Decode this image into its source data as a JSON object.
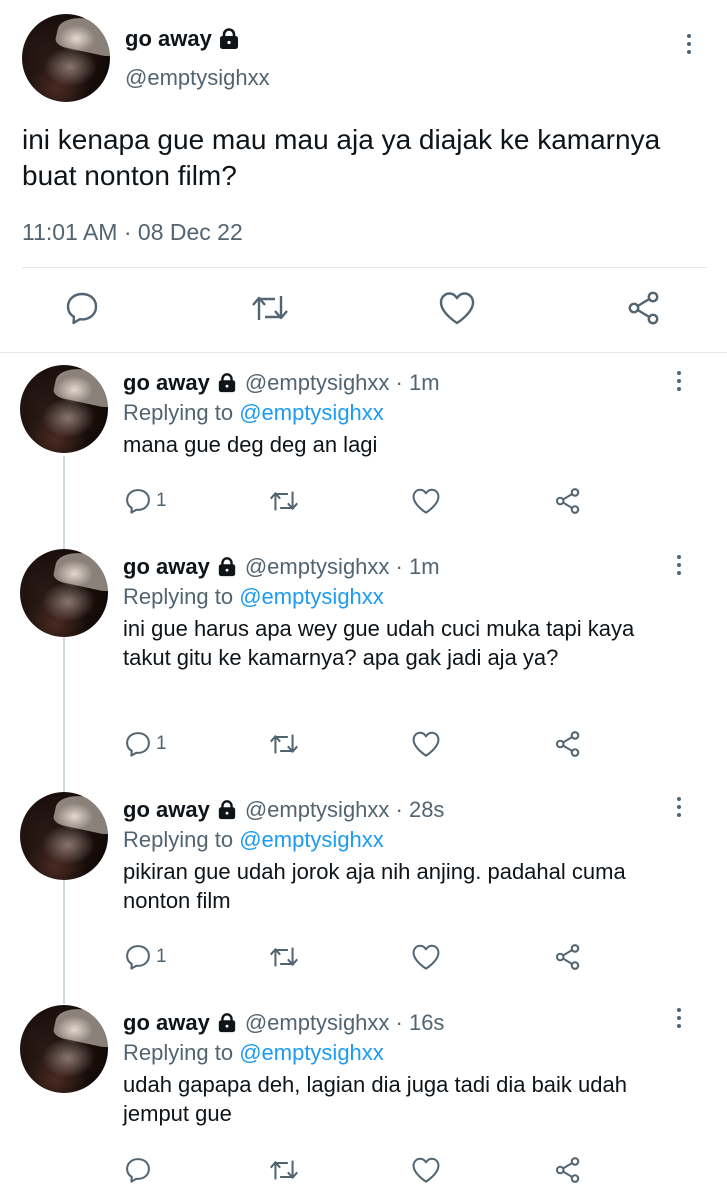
{
  "main_tweet": {
    "display_name": "go away",
    "handle": "@emptysighxx",
    "text": "ini kenapa gue mau mau aja ya diajak ke kamarnya buat nonton film?",
    "timestamp": "11:01 AM · 08 Dec 22"
  },
  "replies": [
    {
      "display_name": "go away",
      "meta": "@emptysighxx · 1m",
      "replying_prefix": "Replying to ",
      "replying_handle": "@emptysighxx",
      "text": "mana gue deg deg an lagi",
      "reply_count": "1"
    },
    {
      "display_name": "go away",
      "meta": "@emptysighxx · 1m",
      "replying_prefix": "Replying to ",
      "replying_handle": "@emptysighxx",
      "text": "ini gue harus apa wey gue udah cuci muka tapi kaya takut gitu ke kamarnya? apa gak jadi aja ya?",
      "reply_count": "1"
    },
    {
      "display_name": "go away",
      "meta": "@emptysighxx · 28s",
      "replying_prefix": "Replying to ",
      "replying_handle": "@emptysighxx",
      "text": "pikiran gue udah jorok aja nih anjing. padahal cuma nonton film",
      "reply_count": "1"
    },
    {
      "display_name": "go away",
      "meta": "@emptysighxx · 16s",
      "replying_prefix": "Replying to ",
      "replying_handle": "@emptysighxx",
      "text": "udah gapapa deh, lagian dia juga tadi dia baik udah jemput gue",
      "reply_count": ""
    }
  ],
  "icons": {
    "reply": "speech-bubble-icon",
    "retweet": "retweet-icon",
    "like": "heart-icon",
    "share": "share-icon",
    "more": "vertical-dots-icon",
    "protected": "lock-icon"
  },
  "colors": {
    "text": "#0f1419",
    "secondary": "#536471",
    "link": "#1d9bf0",
    "divider": "#e1e8ed"
  }
}
